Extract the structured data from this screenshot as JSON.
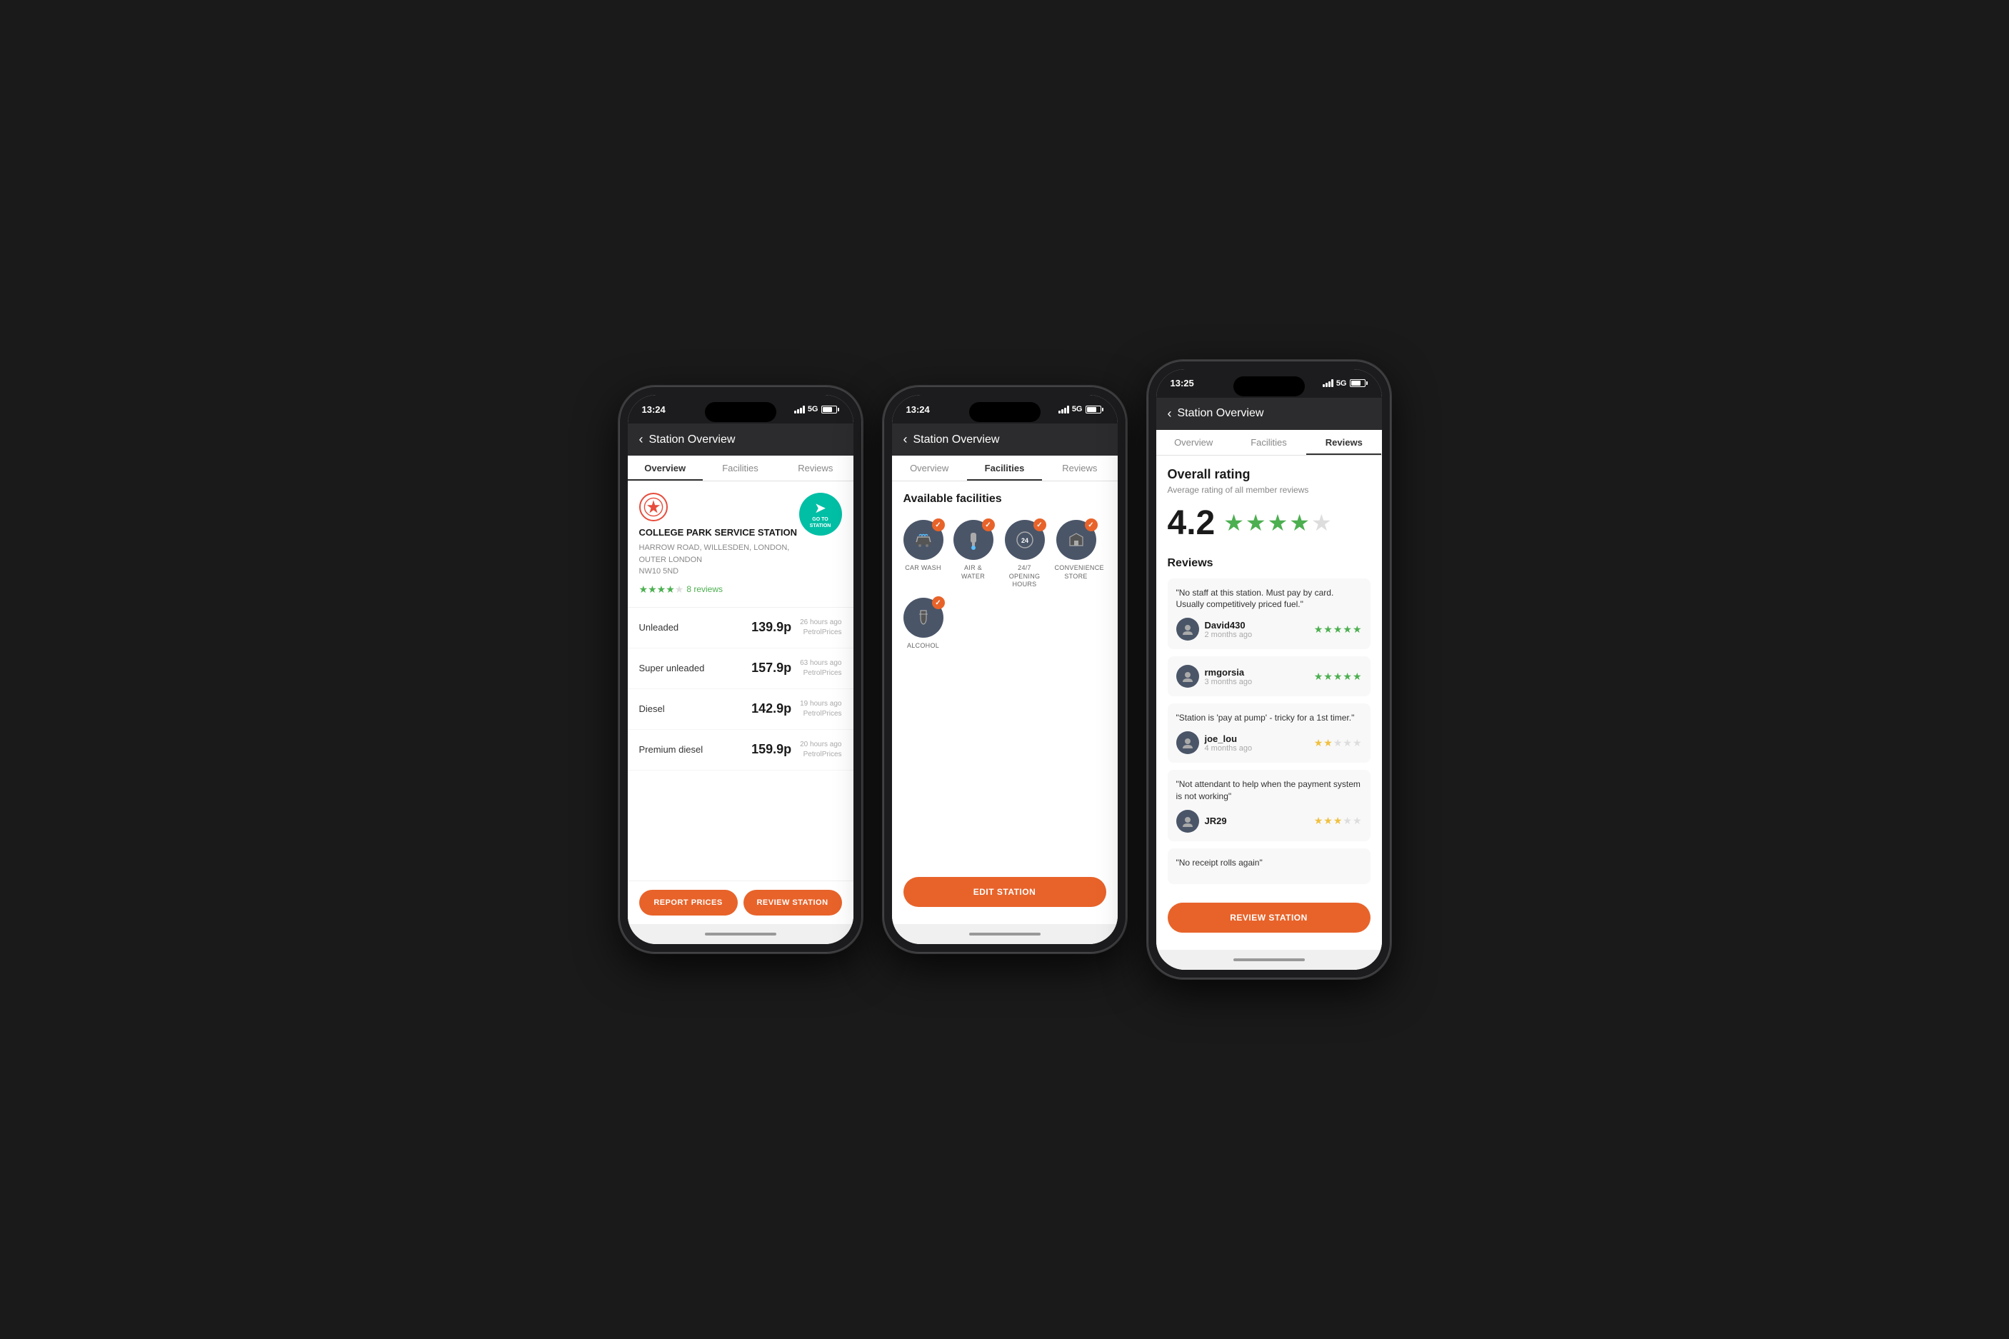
{
  "phones": [
    {
      "id": "phone1",
      "status_time": "13:24",
      "signal": "5G",
      "nav_title": "Station Overview",
      "tabs": [
        "Overview",
        "Facilities",
        "Reviews"
      ],
      "active_tab": 0,
      "station_name": "COLLEGE PARK SERVICE STATION",
      "station_address": "HARROW ROAD, WILLESDEN, LONDON, OUTER LONDON\nNW10 5ND",
      "rating": 4,
      "review_count": "8 reviews",
      "go_to_station_label": "GO TO\nSTATION",
      "fuel_prices": [
        {
          "name": "Unleaded",
          "price": "139.9p",
          "time": "26 hours ago",
          "source": "PetrolPrices"
        },
        {
          "name": "Super unleaded",
          "price": "157.9p",
          "time": "63 hours ago",
          "source": "PetrolPrices"
        },
        {
          "name": "Diesel",
          "price": "142.9p",
          "time": "19 hours ago",
          "source": "PetrolPrices"
        },
        {
          "name": "Premium diesel",
          "price": "159.9p",
          "time": "20 hours ago",
          "source": "PetrolPrices"
        }
      ],
      "button1": "REPORT PRICES",
      "button2": "REVIEW STATION"
    },
    {
      "id": "phone2",
      "status_time": "13:24",
      "signal": "5G",
      "nav_title": "Station Overview",
      "tabs": [
        "Overview",
        "Facilities",
        "Reviews"
      ],
      "active_tab": 1,
      "facilities_title": "Available facilities",
      "facilities": [
        {
          "label": "CAR WASH",
          "icon": "🚗"
        },
        {
          "label": "AIR & WATER",
          "icon": "💧"
        },
        {
          "label": "24/7 OPENING HOURS",
          "icon": "🕐"
        },
        {
          "label": "CONVENIENCE STORE",
          "icon": "🛒"
        },
        {
          "label": "ALCOHOL",
          "icon": "🍷"
        }
      ],
      "button": "EDIT STATION"
    },
    {
      "id": "phone3",
      "status_time": "13:25",
      "signal": "5G",
      "nav_title": "Station Overview",
      "tabs": [
        "Overview",
        "Facilities",
        "Reviews"
      ],
      "active_tab": 2,
      "overall_title": "Overall rating",
      "overall_subtitle": "Average rating of all member reviews",
      "overall_score": "4.2",
      "reviews_section_title": "Reviews",
      "reviews": [
        {
          "quote": "\"No staff at this station. Must pay by card. Usually competitively priced fuel.\"",
          "reviewer": "David430",
          "time": "2 months ago",
          "stars": 5
        },
        {
          "reviewer": "rmgorsia",
          "time": "3 months ago",
          "stars": 5
        },
        {
          "quote": "\"Station is 'pay at pump' - tricky for a 1st timer.\"",
          "reviewer": "joe_lou",
          "time": "4 months ago",
          "stars": 2
        },
        {
          "quote": "\"Not attendant to help when the payment system is not working\"",
          "reviewer": "JR29",
          "time": "",
          "stars": 3
        },
        {
          "quote": "\"No receipt rolls again\"",
          "reviewer": "",
          "time": "",
          "stars": 0
        }
      ],
      "button": "REVIEW STATION"
    }
  ]
}
